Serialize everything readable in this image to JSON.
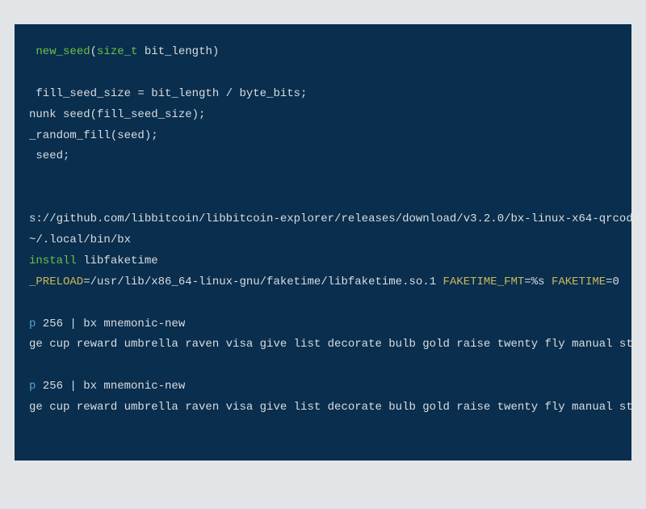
{
  "code": {
    "line1_pre": " ",
    "line1_func": "new_seed",
    "line1_paren_open": "(",
    "line1_type": "size_t",
    "line1_rest": " bit_length)",
    "line2": " fill_seed_size = bit_length / byte_bits;",
    "line3": "nunk seed(fill_seed_size);",
    "line4": "_random_fill(seed);",
    "line5": " seed;",
    "line6": "s://github.com/libbitcoin/libbitcoin-explorer/releases/download/v3.2.0/bx-linux-x64-qrcod",
    "line7": "~/.local/bin/bx",
    "line8_cmd": "install",
    "line8_rest": " libfaketime",
    "line9_var1": "_PRELOAD",
    "line9_val1": "=/usr/lib/x86_64-linux-gnu/faketime/libfaketime.so.1 ",
    "line9_var2": "FAKETIME_FMT",
    "line9_val2": "=%s ",
    "line9_var3": "FAKETIME",
    "line9_val3": "=0",
    "line10_cmd": "p",
    "line10_rest": " 256 | bx mnemonic-new",
    "line11": "ge cup reward umbrella raven visa give list decorate bulb gold raise twenty fly manual st",
    "line12_cmd": "p",
    "line12_rest": " 256 | bx mnemonic-new",
    "line13": "ge cup reward umbrella raven visa give list decorate bulb gold raise twenty fly manual st"
  }
}
